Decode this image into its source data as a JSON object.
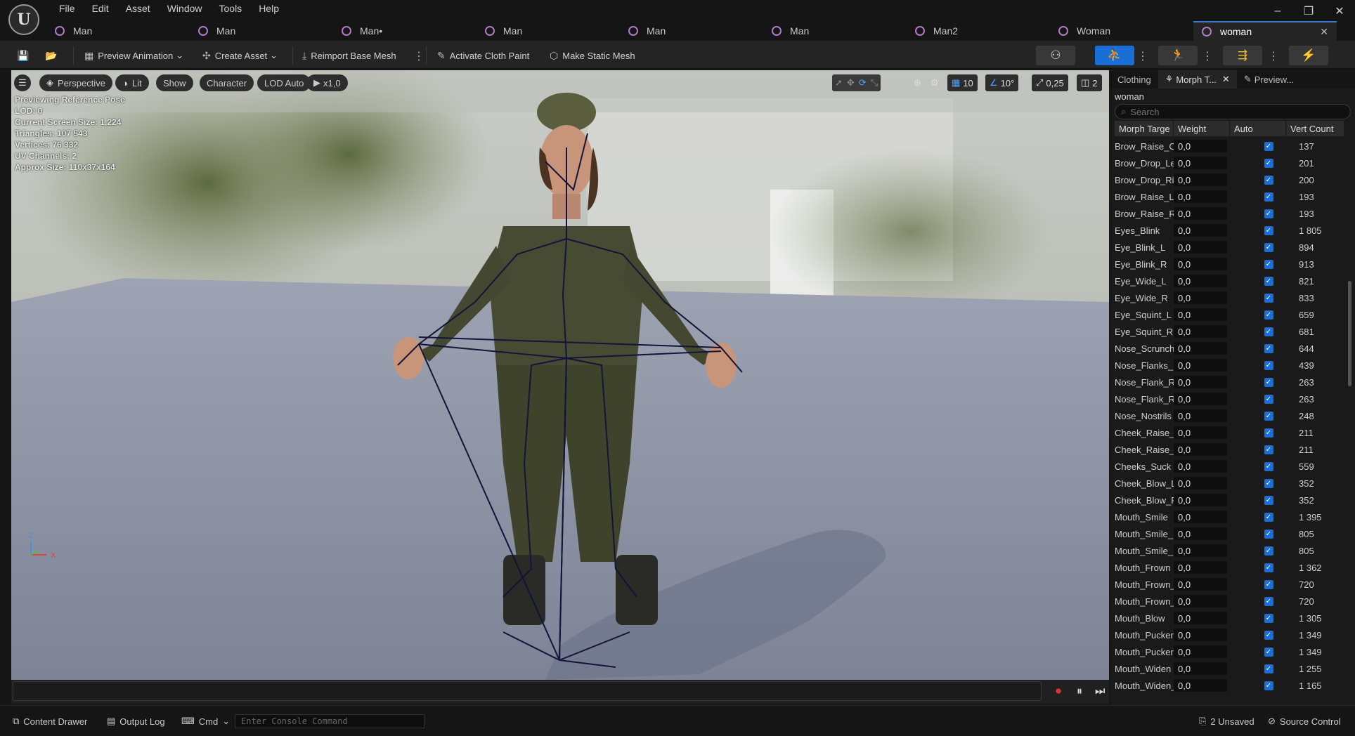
{
  "menubar": {
    "items": [
      "File",
      "Edit",
      "Asset",
      "Window",
      "Tools",
      "Help"
    ],
    "logo": "unreal-logo"
  },
  "window_controls": {
    "minimize": "–",
    "maximize": "❐",
    "close": "✕"
  },
  "tabs": [
    {
      "label": "Man",
      "active": false
    },
    {
      "label": "Man",
      "active": false
    },
    {
      "label": "Man•",
      "active": false
    },
    {
      "label": "Man",
      "active": false
    },
    {
      "label": "Man",
      "active": false
    },
    {
      "label": "Man",
      "active": false
    },
    {
      "label": "Man2",
      "active": false
    },
    {
      "label": "Woman",
      "active": false
    },
    {
      "label": "woman",
      "active": true
    }
  ],
  "toolbar": {
    "preview_animation": "Preview Animation",
    "create_asset": "Create Asset",
    "reimport": "Reimport Base Mesh",
    "activate_cloth": "Activate Cloth Paint",
    "make_static": "Make Static Mesh"
  },
  "viewport": {
    "perspective": "Perspective",
    "lit": "Lit",
    "show": "Show",
    "character": "Character",
    "lod": "LOD Auto",
    "play_rate": "x1,0",
    "grid_snap": "10",
    "rot_snap": "10°",
    "scale_snap": "0,25",
    "camera_speed": "2",
    "stats": [
      "Previewing Reference Pose",
      "LOD: 0",
      "Current Screen Size: 1,224",
      "Triangles: 107 543",
      "Vertices: 76 332",
      "UV Channels: 2",
      "Approx Size: 110x37x164"
    ],
    "axis_z": "Z",
    "axis_x": "X"
  },
  "panel": {
    "tabs": [
      "Clothing",
      "Morph T...",
      "Preview..."
    ],
    "asset_name": "woman",
    "search_placeholder": "Search",
    "columns": [
      "Morph Targe",
      "Weight",
      "Auto",
      "Vert Count"
    ],
    "rows": [
      {
        "name": "Brow_Raise_C",
        "weight": "0,0",
        "vert": "137"
      },
      {
        "name": "Brow_Drop_Le",
        "weight": "0,0",
        "vert": "201"
      },
      {
        "name": "Brow_Drop_Ri",
        "weight": "0,0",
        "vert": "200"
      },
      {
        "name": "Brow_Raise_L",
        "weight": "0,0",
        "vert": "193"
      },
      {
        "name": "Brow_Raise_R",
        "weight": "0,0",
        "vert": "193"
      },
      {
        "name": "Eyes_Blink",
        "weight": "0,0",
        "vert": "1 805"
      },
      {
        "name": "Eye_Blink_L",
        "weight": "0,0",
        "vert": "894"
      },
      {
        "name": "Eye_Blink_R",
        "weight": "0,0",
        "vert": "913"
      },
      {
        "name": "Eye_Wide_L",
        "weight": "0,0",
        "vert": "821"
      },
      {
        "name": "Eye_Wide_R",
        "weight": "0,0",
        "vert": "833"
      },
      {
        "name": "Eye_Squint_L",
        "weight": "0,0",
        "vert": "659"
      },
      {
        "name": "Eye_Squint_R",
        "weight": "0,0",
        "vert": "681"
      },
      {
        "name": "Nose_Scrunch",
        "weight": "0,0",
        "vert": "644"
      },
      {
        "name": "Nose_Flanks_",
        "weight": "0,0",
        "vert": "439"
      },
      {
        "name": "Nose_Flank_R",
        "weight": "0,0",
        "vert": "263"
      },
      {
        "name": "Nose_Flank_R",
        "weight": "0,0",
        "vert": "263"
      },
      {
        "name": "Nose_Nostrils",
        "weight": "0,0",
        "vert": "248"
      },
      {
        "name": "Cheek_Raise_",
        "weight": "0,0",
        "vert": "211"
      },
      {
        "name": "Cheek_Raise_",
        "weight": "0,0",
        "vert": "211"
      },
      {
        "name": "Cheeks_Suck",
        "weight": "0,0",
        "vert": "559"
      },
      {
        "name": "Cheek_Blow_L",
        "weight": "0,0",
        "vert": "352"
      },
      {
        "name": "Cheek_Blow_R",
        "weight": "0,0",
        "vert": "352"
      },
      {
        "name": "Mouth_Smile",
        "weight": "0,0",
        "vert": "1 395"
      },
      {
        "name": "Mouth_Smile_",
        "weight": "0,0",
        "vert": "805"
      },
      {
        "name": "Mouth_Smile_",
        "weight": "0,0",
        "vert": "805"
      },
      {
        "name": "Mouth_Frown",
        "weight": "0,0",
        "vert": "1 362"
      },
      {
        "name": "Mouth_Frown_",
        "weight": "0,0",
        "vert": "720"
      },
      {
        "name": "Mouth_Frown_",
        "weight": "0,0",
        "vert": "720"
      },
      {
        "name": "Mouth_Blow",
        "weight": "0,0",
        "vert": "1 305"
      },
      {
        "name": "Mouth_Pucker",
        "weight": "0,0",
        "vert": "1 349"
      },
      {
        "name": "Mouth_Pucker",
        "weight": "0,0",
        "vert": "1 349"
      },
      {
        "name": "Mouth_Widen",
        "weight": "0,0",
        "vert": "1 255"
      },
      {
        "name": "Mouth_Widen_",
        "weight": "0,0",
        "vert": "1 165"
      }
    ]
  },
  "statusbar": {
    "content_drawer": "Content Drawer",
    "output_log": "Output Log",
    "cmd": "Cmd",
    "console_placeholder": "Enter Console Command",
    "unsaved": "2 Unsaved",
    "source_control": "Source Control"
  }
}
